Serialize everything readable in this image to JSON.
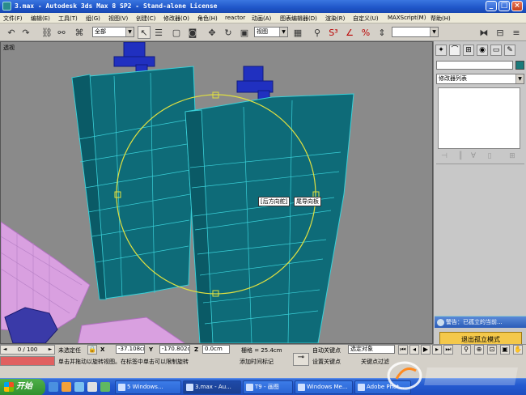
{
  "window": {
    "title": "3.max - Autodesk 3ds Max 8 SP2 - Stand-alone License",
    "min_label": "_",
    "max_label": "□",
    "close_label": "×"
  },
  "menu": [
    "文件(F)",
    "编辑(E)",
    "工具(T)",
    "组(G)",
    "视图(V)",
    "创建(C)",
    "修改器(O)",
    "角色(H)",
    "reactor",
    "动画(A)",
    "图表编辑器(D)",
    "渲染(R)",
    "自定义(U)",
    "MAXScript(M)",
    "帮助(H)"
  ],
  "toolbar": {
    "selection_filter": "全部",
    "coord_system": "视图",
    "icons": [
      "undo-icon",
      "redo-icon",
      "select-link-icon",
      "unlink-icon",
      "bind-spacewarp-icon",
      "select-icon",
      "select-by-name-icon",
      "rect-selection-icon",
      "window-crossing-icon",
      "move-icon",
      "rotate-icon",
      "scale-icon",
      "pivot-icon",
      "manipulate-icon",
      "snap-3-icon",
      "angle-snap-icon",
      "percent-snap-icon",
      "spinner-snap-icon",
      "named-sets-icon",
      "mirror-icon",
      "align-icon"
    ]
  },
  "viewport": {
    "label": "透视",
    "tag_left": "[后方向舵]",
    "tag_right": "尾导向板",
    "accent_object": "#0e6b78",
    "accent_circle": "#e0e040"
  },
  "command_panel": {
    "tabs": [
      "create-icon",
      "modify-icon",
      "hierarchy-icon",
      "motion-icon",
      "display-icon",
      "utilities-icon"
    ],
    "modifier_list": "修改器列表",
    "object_color": "#1a7a7a"
  },
  "warning": {
    "text": "警告：已孤立的当前...",
    "exit_button": "退出孤立模式"
  },
  "status": {
    "time_slider": "0 / 100",
    "selection_info": "未选定任",
    "prompt": "单击并拖动以旋转视图。在标签中单击可以限制旋转",
    "x_label": "X",
    "x_value": "-37.108cm",
    "y_label": "Y",
    "y_value": "-170.802c",
    "z_label": "Z",
    "z_value": "0.0cm",
    "grid": "栅格 = 25.4cm",
    "add_time_tag": "添加时间标记",
    "auto_key": "自动关键点",
    "set_key": "设置关键点",
    "selected_object": "选定对象",
    "key_filters": "关键点过滤"
  },
  "taskbar": {
    "start": "开始",
    "tasks": [
      "5 Windows...",
      "3.max - Au...",
      "T9 - 画图",
      "Windows Me...",
      "Adobe Phot..."
    ]
  }
}
